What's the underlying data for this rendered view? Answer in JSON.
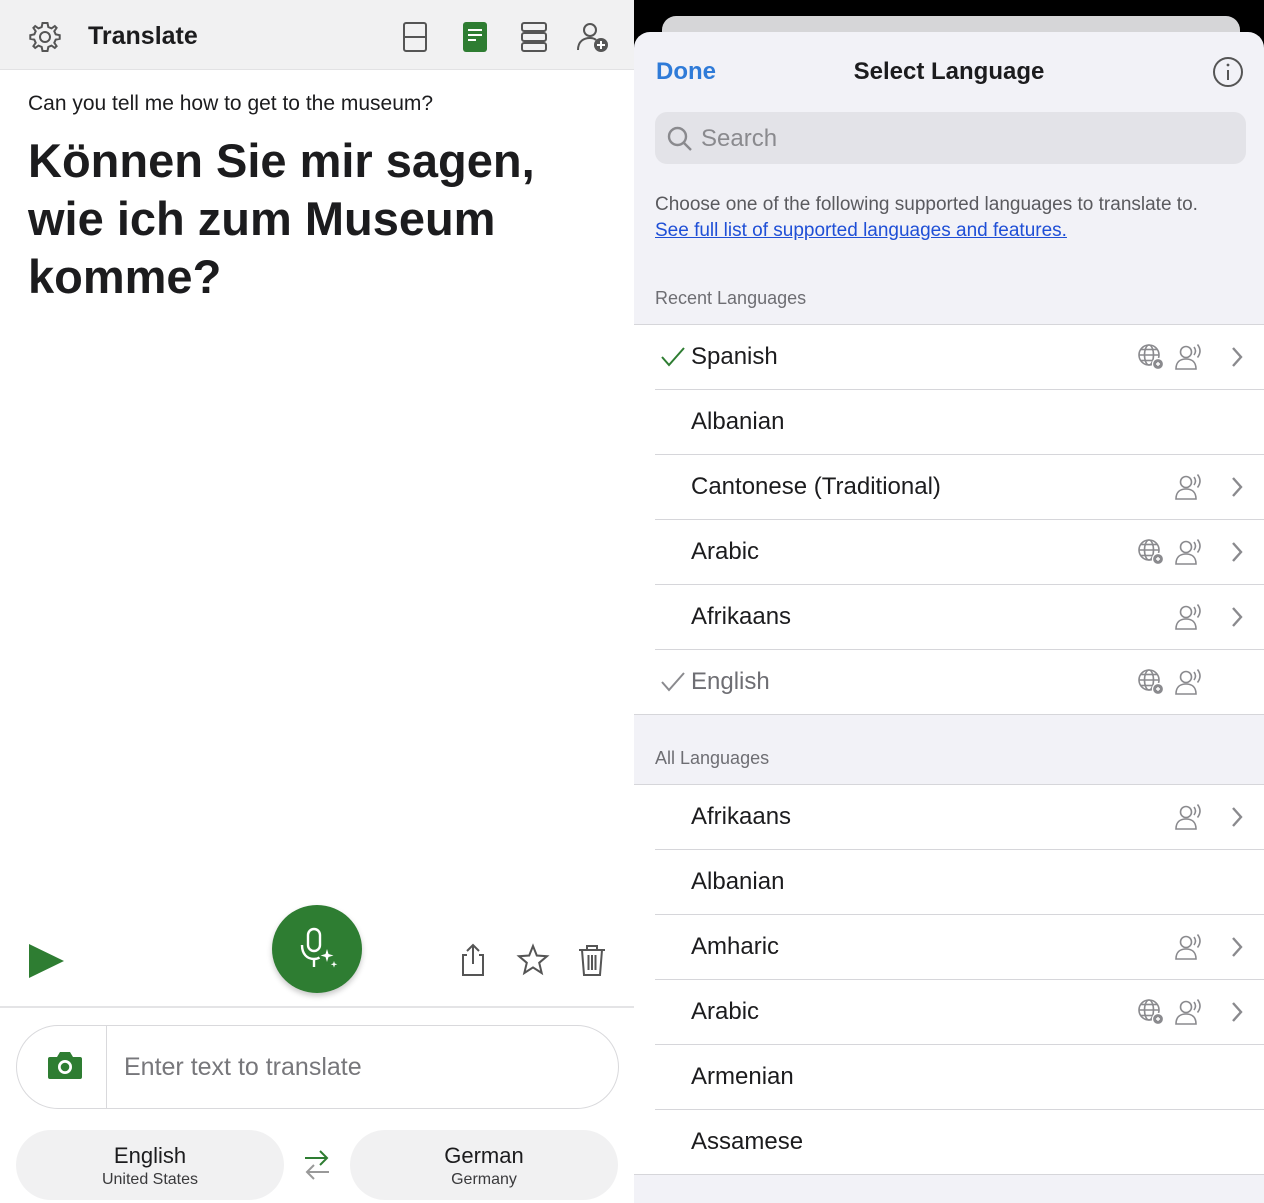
{
  "left": {
    "app_title": "Translate",
    "source_text": "Can you tell me how to get to the museum?",
    "translation_text": "Können Sie mir sagen, wie ich zum Museum komme?",
    "input_placeholder": "Enter text to translate",
    "source_language": {
      "name": "English",
      "region": "United States"
    },
    "target_language": {
      "name": "German",
      "region": "Germany"
    },
    "toolbar_icons": [
      "settings-icon",
      "split-view-icon",
      "single-view-icon",
      "list-view-icon",
      "add-person-icon"
    ],
    "action_icons": [
      "play-icon",
      "share-icon",
      "star-icon",
      "trash-icon",
      "camera-icon",
      "mic-sparkle-icon",
      "swap-icon"
    ],
    "accent_color": "#2e7d32"
  },
  "right": {
    "done_label": "Done",
    "title": "Select Language",
    "search_placeholder": "Search",
    "description": "Choose one of the following supported languages to translate to.",
    "description_link": "See full list of supported languages and features.",
    "recent_header": "Recent Languages",
    "all_header": "All Languages",
    "link_color": "#1f4fd6",
    "done_color": "#2f7bd8",
    "recent": [
      {
        "name": "Spanish",
        "checked": true,
        "check_color": "green",
        "offline": true,
        "speech": true,
        "chevron": true
      },
      {
        "name": "Albanian",
        "checked": false,
        "offline": false,
        "speech": false,
        "chevron": false
      },
      {
        "name": "Cantonese (Traditional)",
        "checked": false,
        "offline": false,
        "speech": true,
        "chevron": true
      },
      {
        "name": "Arabic",
        "checked": false,
        "offline": true,
        "speech": true,
        "chevron": true
      },
      {
        "name": "Afrikaans",
        "checked": false,
        "offline": false,
        "speech": true,
        "chevron": true
      },
      {
        "name": "English",
        "checked": true,
        "check_color": "gray",
        "dimmed": true,
        "offline": true,
        "speech": true,
        "chevron": false
      }
    ],
    "all": [
      {
        "name": "Afrikaans",
        "offline": false,
        "speech": true,
        "chevron": true
      },
      {
        "name": "Albanian",
        "offline": false,
        "speech": false,
        "chevron": false
      },
      {
        "name": "Amharic",
        "offline": false,
        "speech": true,
        "chevron": true
      },
      {
        "name": "Arabic",
        "offline": true,
        "speech": true,
        "chevron": true
      },
      {
        "name": "Armenian",
        "offline": false,
        "speech": false,
        "chevron": false
      },
      {
        "name": "Assamese",
        "offline": false,
        "speech": false,
        "chevron": false
      }
    ]
  }
}
